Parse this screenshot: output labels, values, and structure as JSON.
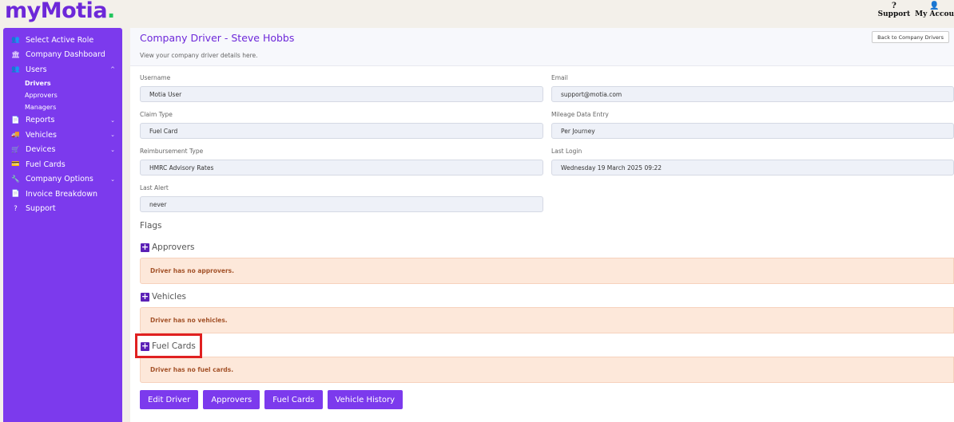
{
  "brand": {
    "name_a": "my",
    "name_b": "Motia",
    "dot": "."
  },
  "topnav": [
    {
      "icon": "?",
      "label": "Support"
    },
    {
      "icon": "👤",
      "label": "My Accou"
    }
  ],
  "sidebar": {
    "items": [
      {
        "icon": "👥",
        "label": "Select Active Role"
      },
      {
        "icon": "🏛",
        "label": "Company Dashboard"
      },
      {
        "icon": "👥",
        "label": "Users",
        "chevron": "^"
      },
      {
        "icon": "📄",
        "label": "Reports",
        "chevron": "⌄"
      },
      {
        "icon": "🚚",
        "label": "Vehicles",
        "chevron": "⌄"
      },
      {
        "icon": "🛒",
        "label": "Devices",
        "chevron": "⌄"
      },
      {
        "icon": "💳",
        "label": "Fuel Cards"
      },
      {
        "icon": "🔧",
        "label": "Company Options",
        "chevron": "⌄"
      },
      {
        "icon": "📄",
        "label": "Invoice Breakdown"
      },
      {
        "icon": "?",
        "label": "Support"
      }
    ],
    "users_sub": [
      "Drivers",
      "Approvers",
      "Managers"
    ]
  },
  "page": {
    "title": "Company Driver - Steve Hobbs",
    "subtitle": "View your company driver details here.",
    "back_button": "Back to Company Drivers"
  },
  "fields": {
    "username": {
      "label": "Username",
      "value": "Motia User"
    },
    "email": {
      "label": "Email",
      "value": "support@motia.com"
    },
    "claim_type": {
      "label": "Claim Type",
      "value": "Fuel Card"
    },
    "mileage": {
      "label": "Mileage Data Entry",
      "value": "Per Journey"
    },
    "reimbursement": {
      "label": "Reimbursement Type",
      "value": "HMRC Advisory Rates"
    },
    "last_login": {
      "label": "Last Login",
      "value": "Wednesday 19 March 2025 09:22"
    },
    "last_alert": {
      "label": "Last Alert",
      "value": "never"
    }
  },
  "flags_label": "Flags",
  "sections": {
    "approvers": {
      "title": "Approvers",
      "alert": "Driver has no approvers."
    },
    "vehicles": {
      "title": "Vehicles",
      "alert": "Driver has no vehicles."
    },
    "fuel_cards": {
      "title": "Fuel Cards",
      "alert": "Driver has no fuel cards."
    }
  },
  "buttons": {
    "edit_driver": "Edit Driver",
    "approvers": "Approvers",
    "fuel_cards": "Fuel Cards",
    "vehicle_history": "Vehicle History"
  },
  "colors": {
    "accent": "#7c3aed",
    "highlight": "#e02020",
    "alert_bg": "#fde8da"
  }
}
